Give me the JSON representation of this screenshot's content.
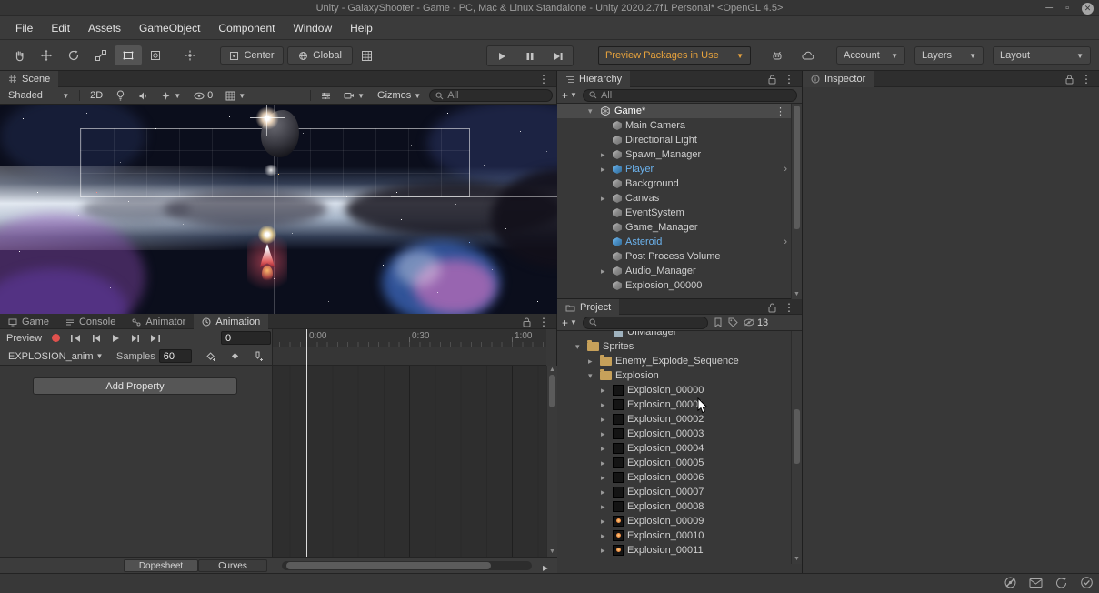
{
  "window": {
    "title": "Unity - GalaxyShooter - Game - PC, Mac & Linux Standalone - Unity 2020.2.7f1 Personal* <OpenGL 4.5>"
  },
  "menubar": {
    "items": [
      "File",
      "Edit",
      "Assets",
      "GameObject",
      "Component",
      "Window",
      "Help"
    ]
  },
  "toolbar": {
    "pivot_label": "Center",
    "space_label": "Global",
    "preview_packages_label": "Preview Packages in Use",
    "account_label": "Account",
    "layers_label": "Layers",
    "layout_label": "Layout",
    "accent_orange": "#E8A33D"
  },
  "scene_panel": {
    "tab_label": "Scene",
    "draw_mode": "Shaded",
    "toggle_2d": "2D",
    "hidden_count": "0",
    "gizmos_label": "Gizmos",
    "search_text": "All"
  },
  "animation_panel": {
    "tabs": [
      "Game",
      "Console",
      "Animator",
      "Animation"
    ],
    "active_tab": "Animation",
    "preview_label": "Preview",
    "frame_value": "0",
    "clip_name": "EXPLOSION_anim",
    "samples_label": "Samples",
    "samples_value": "60",
    "add_property_label": "Add Property",
    "ruler": [
      "0:00",
      "0:30",
      "1:00"
    ],
    "bottom_tabs": [
      "Dopesheet",
      "Curves"
    ]
  },
  "hierarchy_panel": {
    "tab_label": "Hierarchy",
    "search_text": "All",
    "scene_row_label": "Game*",
    "items": [
      "Main Camera",
      "Directional Light",
      "Spawn_Manager",
      "Player",
      "Background",
      "Canvas",
      "EventSystem",
      "Game_Manager",
      "Asteroid",
      "Post Process Volume",
      "Audio_Manager",
      "Explosion_00000"
    ],
    "prefab_text_color": "#6CB3EE"
  },
  "project_panel": {
    "tab_label": "Project",
    "hidden_count": "13",
    "partial_item": "UIManager",
    "folders": [
      "Sprites",
      "Enemy_Explode_Sequence",
      "Explosion"
    ],
    "sprites": [
      "Explosion_00000",
      "Explosion_00001",
      "Explosion_00002",
      "Explosion_00003",
      "Explosion_00004",
      "Explosion_00005",
      "Explosion_00006",
      "Explosion_00007",
      "Explosion_00008",
      "Explosion_00009",
      "Explosion_00010",
      "Explosion_00011"
    ]
  },
  "inspector_panel": {
    "tab_label": "Inspector"
  }
}
